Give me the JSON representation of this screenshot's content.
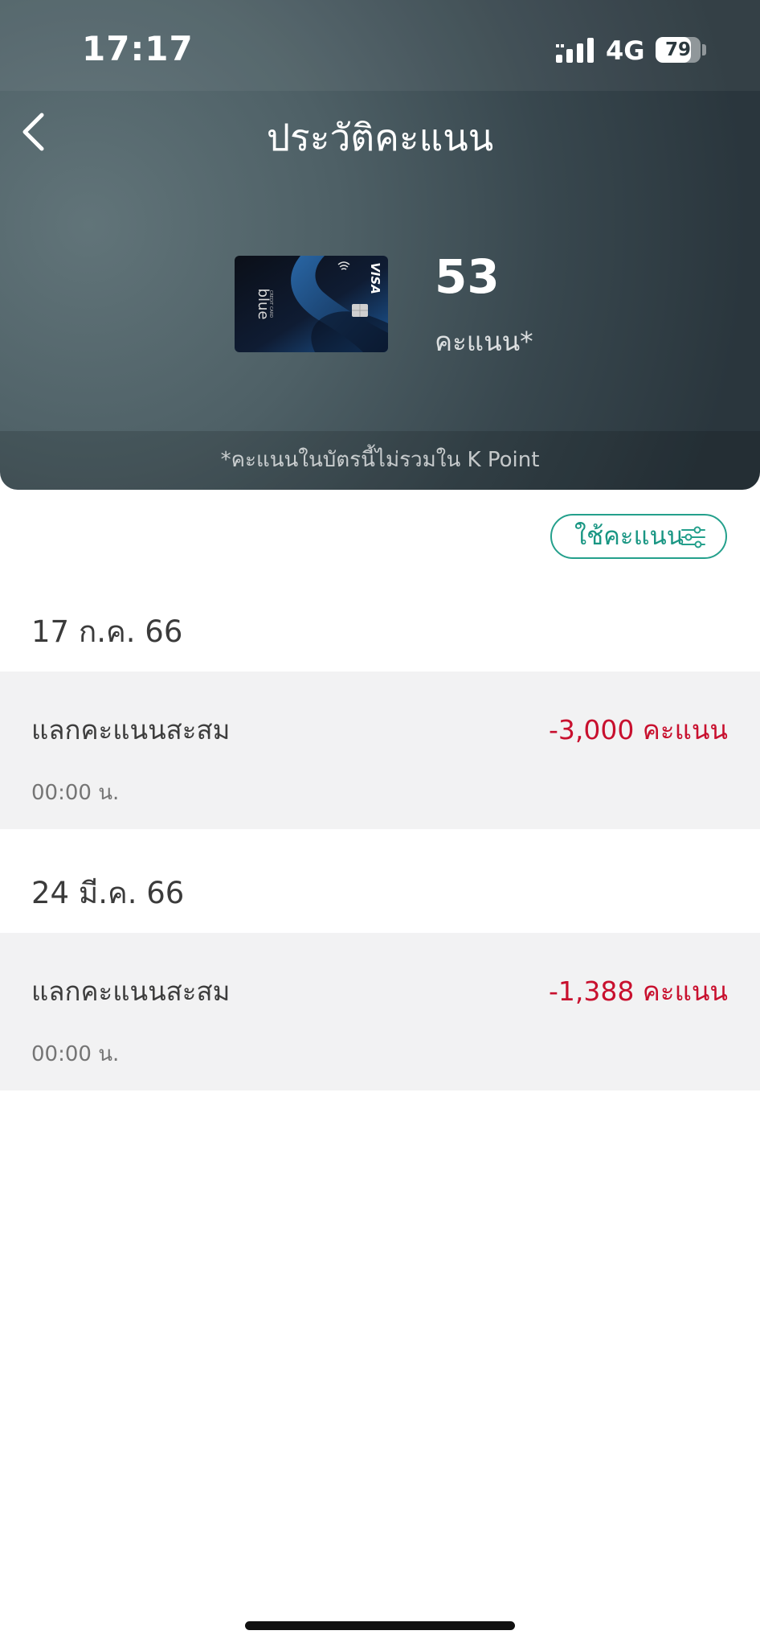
{
  "status_bar": {
    "time": "17:17",
    "network": "4G",
    "battery_level": "79",
    "battery_fraction": 0.79,
    "signal_icon": "signal-bars-icon"
  },
  "header": {
    "title": "ประวัติคะแนน",
    "back_icon": "chevron-left-icon",
    "card": {
      "brand_text": "blue",
      "network_text": "VISA",
      "card_type_text": "CREDIT CARD",
      "icon_contactless": "contactless-icon",
      "icon_chip": "chip-icon"
    },
    "points_value": "53",
    "points_unit": "คะแนน*",
    "note": "*คะแนนในบัตรนี้ไม่รวมใน K Point",
    "background_colors": [
      "#617479",
      "#2a363d"
    ]
  },
  "filter": {
    "label": "ใช้คะแนน",
    "icon": "filter-sliders-icon",
    "accent_color": "#24a08c"
  },
  "history": [
    {
      "date": "17 ก.ค. 66",
      "items": [
        {
          "title": "แลกคะแนนสะสม",
          "amount": "-3,000 คะแนน",
          "time": "00:00 น."
        }
      ]
    },
    {
      "date": "24 มี.ค. 66",
      "items": [
        {
          "title": "แลกคะแนนสะสม",
          "amount": "-1,388 คะแนน",
          "time": "00:00 น."
        }
      ]
    }
  ],
  "colors": {
    "negative_amount": "#c8102e",
    "row_background": "#f2f2f3"
  }
}
